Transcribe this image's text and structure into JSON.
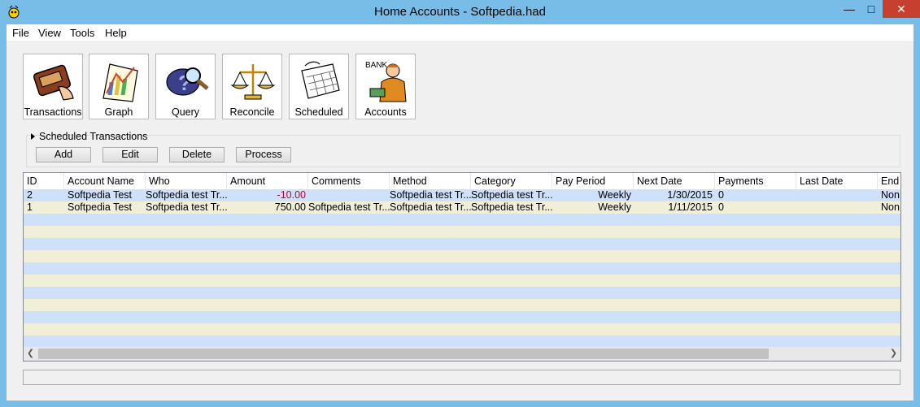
{
  "window": {
    "title": "Home Accounts - Softpedia.had"
  },
  "menu": [
    "File",
    "View",
    "Tools",
    "Help"
  ],
  "toolbar": [
    {
      "label": "Transactions",
      "icon": "wallet-icon"
    },
    {
      "label": "Graph",
      "icon": "graph-icon"
    },
    {
      "label": "Query",
      "icon": "query-icon"
    },
    {
      "label": "Reconcile",
      "icon": "scales-icon"
    },
    {
      "label": "Scheduled",
      "icon": "calendar-icon"
    },
    {
      "label": "Accounts",
      "icon": "bank-icon"
    }
  ],
  "accounts_icon_text": "BANK",
  "scheduled": {
    "header": "Scheduled Transactions",
    "buttons": [
      "Add",
      "Edit",
      "Delete",
      "Process"
    ]
  },
  "grid": {
    "columns": [
      "ID",
      "Account Name",
      "Who",
      "Amount",
      "Comments",
      "Method",
      "Category",
      "Pay Period",
      "Next Date",
      "Payments",
      "Last Date",
      "End"
    ],
    "rows": [
      [
        "2",
        "Softpedia Test",
        "Softpedia test Tr...",
        "-10.00",
        "",
        "Softpedia test Tr...",
        "Softpedia test Tr...",
        "Weekly",
        "1/30/2015",
        "0",
        "",
        "Non"
      ],
      [
        "1",
        "Softpedia Test",
        "Softpedia test Tr...",
        "750.00",
        "Softpedia test Tr...",
        "Softpedia test Tr...",
        "Softpedia test Tr...",
        "Weekly",
        "1/11/2015",
        "0",
        "",
        "Non"
      ]
    ]
  },
  "colors": {
    "negative": "#c0002a",
    "row_blue": "#cfe0fa",
    "row_yellow": "#f2efd8",
    "close_button": "#c7402f"
  }
}
